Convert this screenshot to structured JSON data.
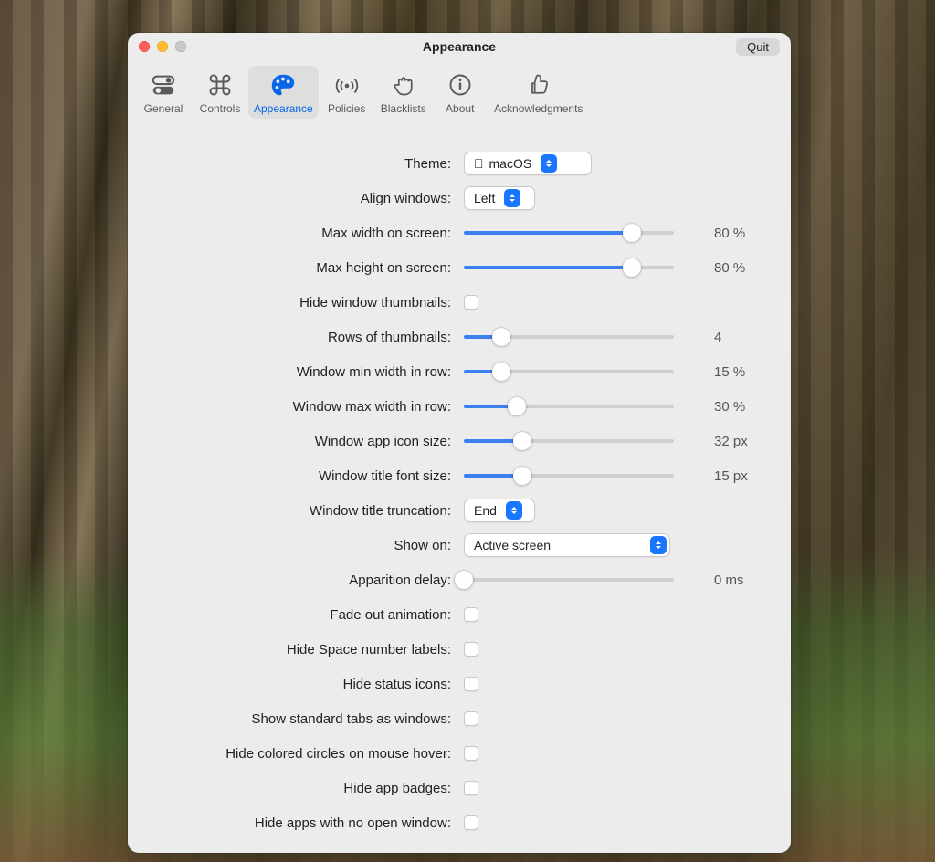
{
  "window": {
    "title": "Appearance",
    "quit": "Quit"
  },
  "tabs": [
    {
      "id": "general",
      "label": "General"
    },
    {
      "id": "controls",
      "label": "Controls"
    },
    {
      "id": "appearance",
      "label": "Appearance"
    },
    {
      "id": "policies",
      "label": "Policies"
    },
    {
      "id": "blacklists",
      "label": "Blacklists"
    },
    {
      "id": "about",
      "label": "About"
    },
    {
      "id": "ack",
      "label": "Acknowledgments"
    }
  ],
  "active_tab": "appearance",
  "settings": {
    "theme": {
      "label": "Theme:",
      "value": "macOS"
    },
    "align": {
      "label": "Align windows:",
      "value": "Left"
    },
    "max_width": {
      "label": "Max width on screen:",
      "pct": 80,
      "display": "80 %"
    },
    "max_height": {
      "label": "Max height on screen:",
      "pct": 80,
      "display": "80 %"
    },
    "hide_thumbs": {
      "label": "Hide window thumbnails:",
      "checked": false
    },
    "rows": {
      "label": "Rows of thumbnails:",
      "pct": 18,
      "display": "4"
    },
    "min_w": {
      "label": "Window min width in row:",
      "pct": 18,
      "display": "15 %"
    },
    "max_w": {
      "label": "Window max width in row:",
      "pct": 25,
      "display": "30 %"
    },
    "icon_size": {
      "label": "Window app icon size:",
      "pct": 28,
      "display": "32 px"
    },
    "font_size": {
      "label": "Window title font size:",
      "pct": 28,
      "display": "15 px"
    },
    "truncation": {
      "label": "Window title truncation:",
      "value": "End"
    },
    "show_on": {
      "label": "Show on:",
      "value": "Active screen"
    },
    "delay": {
      "label": "Apparition delay:",
      "pct": 0,
      "display": "0 ms"
    },
    "fade": {
      "label": "Fade out animation:",
      "checked": false
    },
    "hide_space": {
      "label": "Hide Space number labels:",
      "checked": false
    },
    "hide_status": {
      "label": "Hide status icons:",
      "checked": false
    },
    "std_tabs": {
      "label": "Show standard tabs as windows:",
      "checked": false
    },
    "hide_circles": {
      "label": "Hide colored circles on mouse hover:",
      "checked": false
    },
    "hide_badges": {
      "label": "Hide app badges:",
      "checked": false
    },
    "hide_no_window": {
      "label": "Hide apps with no open window:",
      "checked": false
    }
  }
}
